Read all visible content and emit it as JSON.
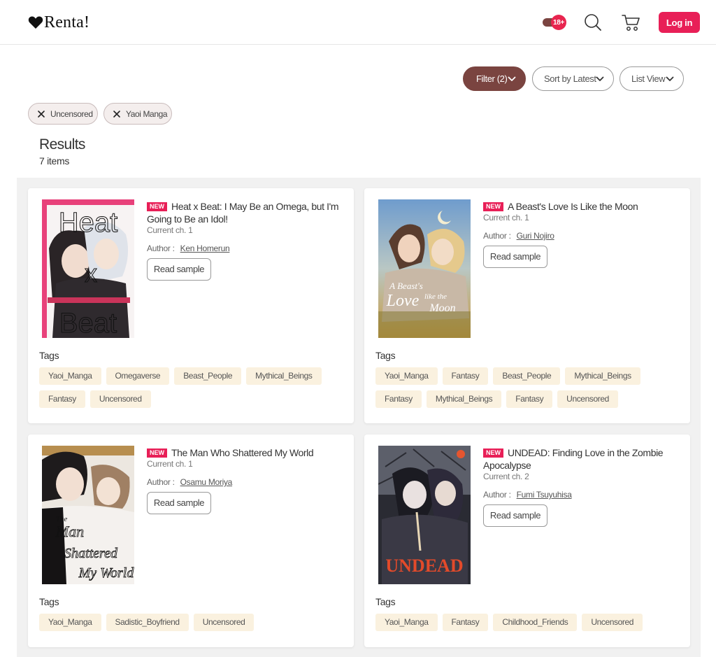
{
  "header": {
    "logo_text": "Renta!",
    "adult_badge": "18+",
    "login_label": "Log in"
  },
  "toolbar": {
    "filter_label": "Filter (2)",
    "sort_label": "Sort by Latest",
    "view_label": "List View"
  },
  "active_filters": [
    {
      "label": "Uncensored"
    },
    {
      "label": "Yaoi Manga"
    }
  ],
  "results": {
    "title": "Results",
    "count": "7 items"
  },
  "cards": [
    {
      "badge": "NEW",
      "title": "Heat x Beat: I May Be an Omega, but I'm Going to Be an Idol!",
      "chapter": "Current ch. 1",
      "author_label": "Author :",
      "author": "Ken Homerun",
      "sample_label": "Read sample",
      "tags_label": "Tags",
      "tags": [
        "Yaoi_Manga",
        "Omegaverse",
        "Beast_People",
        "Mythical_Beings",
        "Fantasy",
        "Uncensored"
      ]
    },
    {
      "badge": "NEW",
      "title": "A Beast's Love Is Like the Moon",
      "chapter": "Current ch. 1",
      "author_label": "Author :",
      "author": "Guri Nojiro",
      "sample_label": "Read sample",
      "tags_label": "Tags",
      "tags": [
        "Yaoi_Manga",
        "Fantasy",
        "Beast_People",
        "Mythical_Beings",
        "Fantasy",
        "Mythical_Beings",
        "Fantasy",
        "Uncensored"
      ]
    },
    {
      "badge": "NEW",
      "title": "The Man Who Shattered My World",
      "chapter": "Current ch. 1",
      "author_label": "Author :",
      "author": "Osamu Moriya",
      "sample_label": "Read sample",
      "tags_label": "Tags",
      "tags": [
        "Yaoi_Manga",
        "Sadistic_Boyfriend",
        "Uncensored"
      ]
    },
    {
      "badge": "NEW",
      "title": "UNDEAD: Finding Love in the Zombie Apocalypse",
      "chapter": "Current ch. 2",
      "author_label": "Author :",
      "author": "Fumi Tsuyuhisa",
      "sample_label": "Read sample",
      "tags_label": "Tags",
      "tags": [
        "Yaoi_Manga",
        "Fantasy",
        "Childhood_Friends",
        "Uncensored"
      ]
    }
  ],
  "cover_art": [
    {
      "artwork_text": [
        "Heat",
        "x",
        "Beat"
      ]
    },
    {
      "artwork_text": [
        "A Beast's",
        "Love",
        "like the",
        "Moon"
      ]
    },
    {
      "artwork_text": [
        "The",
        "Man",
        "Shattered",
        "My World"
      ]
    },
    {
      "artwork_text": [
        "UNDEAD"
      ]
    }
  ],
  "colors": {
    "brand": "#e81f57",
    "filter_active": "#7a4440",
    "tag_bg": "#faf1df"
  }
}
